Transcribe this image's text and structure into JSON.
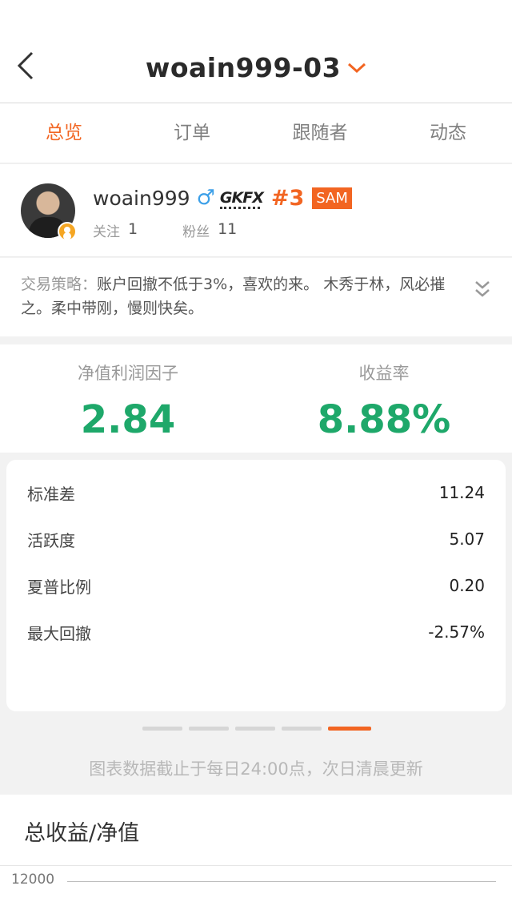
{
  "nav": {
    "title": "woain999-03",
    "back_icon": "chevron-left-icon",
    "dropdown_icon": "chevron-down-icon",
    "accent_color": "#f26522"
  },
  "tabs": [
    {
      "label": "总览",
      "active": true
    },
    {
      "label": "订单",
      "active": false
    },
    {
      "label": "跟随者",
      "active": false
    },
    {
      "label": "动态",
      "active": false
    }
  ],
  "profile": {
    "username": "woain999",
    "gender_icon": "♂",
    "broker_logo": "GKFX",
    "rank": "#3",
    "badge": "SAM",
    "following_label": "关注",
    "following_count": "1",
    "followers_label": "粉丝",
    "followers_count": "11"
  },
  "strategy": {
    "label": "交易策略：",
    "text": "账户回撤不低于3%，喜欢的来。    木秀于林，风必摧之。柔中带刚，慢则快矣。"
  },
  "performance": {
    "profit_factor_label": "净值利润因子",
    "profit_factor_value": "2.84",
    "return_label": "收益率",
    "return_value": "8.88%",
    "value_color": "#1ea86a"
  },
  "metrics": [
    {
      "label": "标准差",
      "value": "11.24"
    },
    {
      "label": "活跃度",
      "value": "5.07"
    },
    {
      "label": "夏普比例",
      "value": "0.20"
    },
    {
      "label": "最大回撤",
      "value": "-2.57%"
    }
  ],
  "pager": {
    "count": 5,
    "active_index": 4
  },
  "note": "图表数据截止于每日24:00点，次日清晨更新",
  "chart": {
    "title": "总收益/净值",
    "y_tick_top": "12000"
  }
}
